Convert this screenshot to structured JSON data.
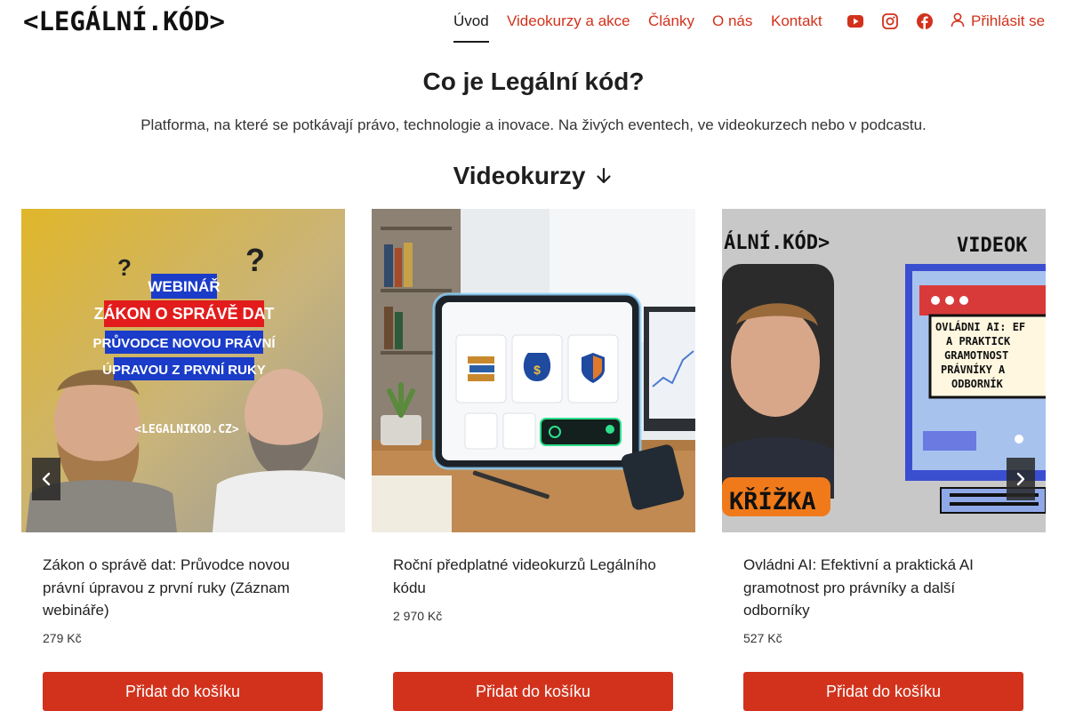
{
  "header": {
    "logo_text": "<LEGÁLNÍ.KÓD>",
    "nav": [
      {
        "label": "Úvod",
        "active": true
      },
      {
        "label": "Videokurzy a akce",
        "active": false
      },
      {
        "label": "Články",
        "active": false
      },
      {
        "label": "O nás",
        "active": false
      },
      {
        "label": "Kontakt",
        "active": false
      }
    ],
    "social_icons": [
      "youtube-icon",
      "instagram-icon",
      "facebook-icon"
    ],
    "login_label": "Přihlásit se"
  },
  "intro": {
    "title": "Co je Legální kód?",
    "subtitle": "Platforma, na které se potkávají právo, technologie a inovace. Na živých eventech, ve videokurzech nebo v podcastu."
  },
  "videokurzy": {
    "heading": "Videokurzy",
    "cards": [
      {
        "name": "Zákon o správě dat: Průvodce novou právní úpravou z první ruky (Záznam webináře)",
        "price": "279 Kč",
        "button": "Přidat do košíku",
        "image": {
          "badge": "WEBINÁŘ",
          "line1": "ZÁKON O SPRÁVĚ DAT",
          "line2": "PRŮVODCE NOVOU PRÁVNÍ",
          "line3": "ÚPRAVOU Z PRVNÍ RUKY",
          "site": "<LEGALNIKOD.CZ>"
        }
      },
      {
        "name": "Roční předplatné videokurzů Legálního kódu",
        "price": "2 970 Kč",
        "button": "Přidat do košíku"
      },
      {
        "name": "Ovládni AI: Efektivní a praktická AI gramotnost pro právníky a další odborníky",
        "price": "527 Kč",
        "button": "Přidat do košíku",
        "image": {
          "logo": "ÁLNÍ.KÓD>",
          "tag": "VIDEOK",
          "screen_text": "OVLÁDNI AI: EF A PRAKTICK GRAMOTNOST PRÁVNÍKY A ODBORNÍK",
          "name_tag": "KŘÍŽKA"
        }
      }
    ]
  },
  "colors": {
    "accent": "#d2321c",
    "text": "#1a1a1a"
  }
}
